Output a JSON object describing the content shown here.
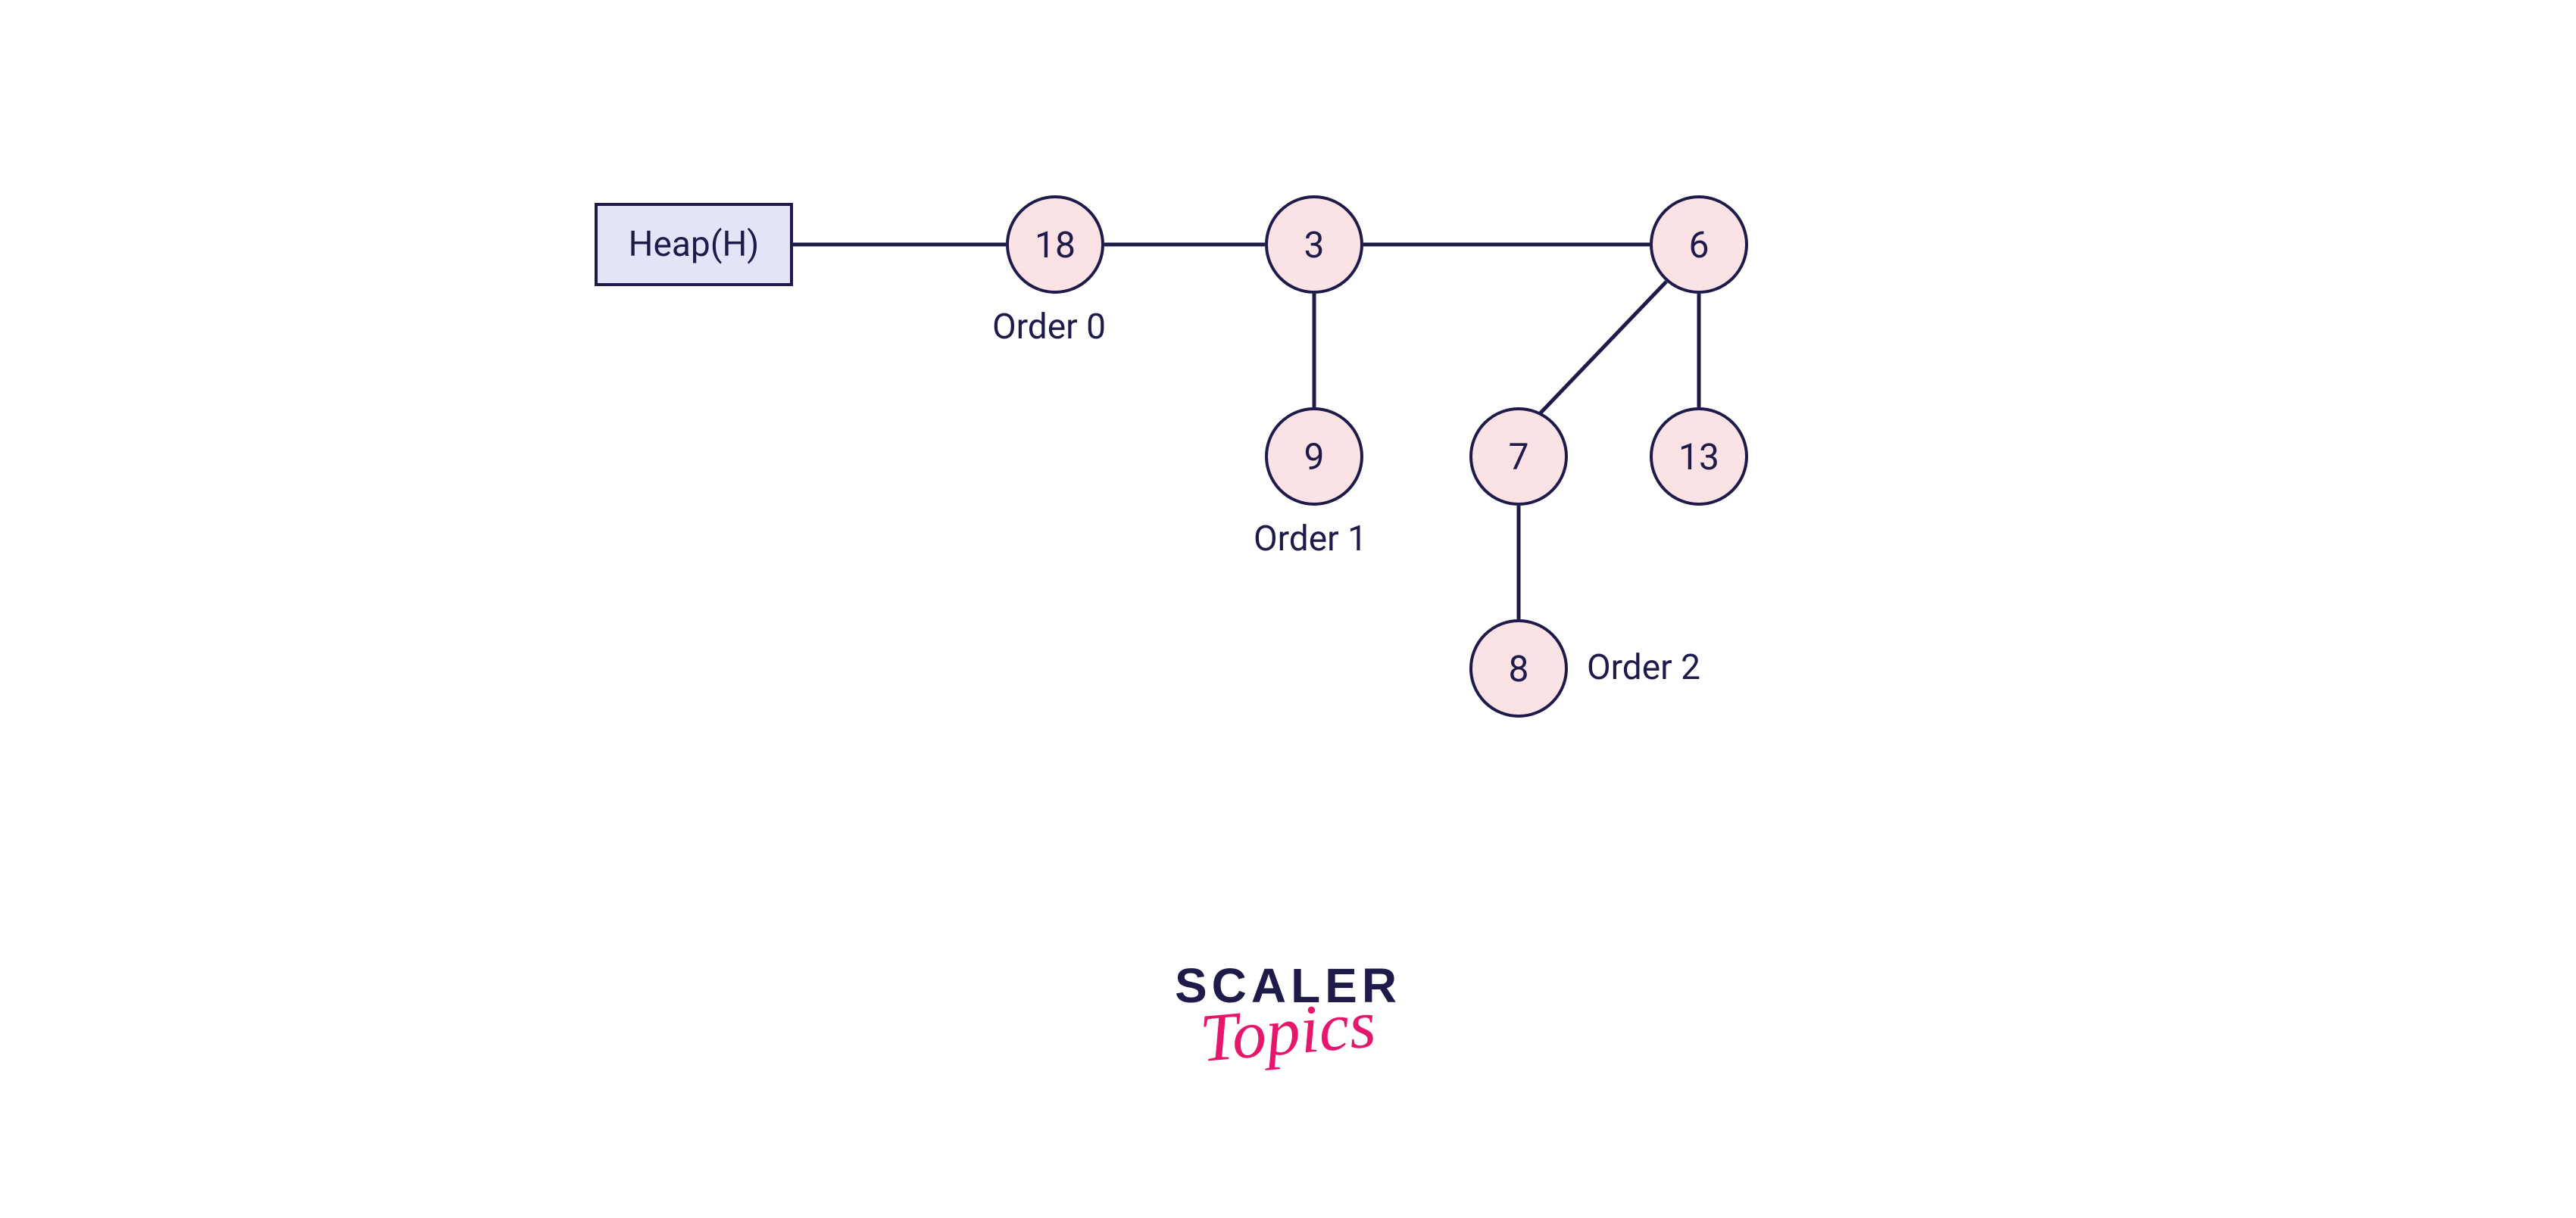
{
  "heap": {
    "label": "Heap(H)"
  },
  "nodes": {
    "n18": "18",
    "n3": "3",
    "n6": "6",
    "n9": "9",
    "n7": "7",
    "n13": "13",
    "n8": "8"
  },
  "orders": {
    "o0": "Order 0",
    "o1": "Order 1",
    "o2": "Order 2"
  },
  "brand": {
    "scaler": "SCALER",
    "topics": "Topics"
  },
  "colors": {
    "nodeFill": "#FBE2E5",
    "nodeStroke": "#1E1B4B",
    "boxFill": "#E3E4F7",
    "brandAccent": "#E6166C"
  },
  "chart_data": {
    "type": "diagram",
    "structure": "binomial-heap",
    "root_pointer": "Heap(H)",
    "trees": [
      {
        "order": 0,
        "order_label": "Order 0",
        "root": 18,
        "children": []
      },
      {
        "order": 1,
        "order_label": "Order 1",
        "root": 3,
        "children": [
          {
            "value": 9,
            "children": []
          }
        ]
      },
      {
        "order": 2,
        "order_label": "Order 2",
        "root": 6,
        "children": [
          {
            "value": 7,
            "children": [
              {
                "value": 8,
                "children": []
              }
            ]
          },
          {
            "value": 13,
            "children": []
          }
        ]
      }
    ],
    "root_list_edges": [
      [
        "Heap(H)",
        18
      ],
      [
        18,
        3
      ],
      [
        3,
        6
      ]
    ],
    "tree_edges": [
      [
        3,
        9
      ],
      [
        6,
        7
      ],
      [
        6,
        13
      ],
      [
        7,
        8
      ]
    ]
  }
}
